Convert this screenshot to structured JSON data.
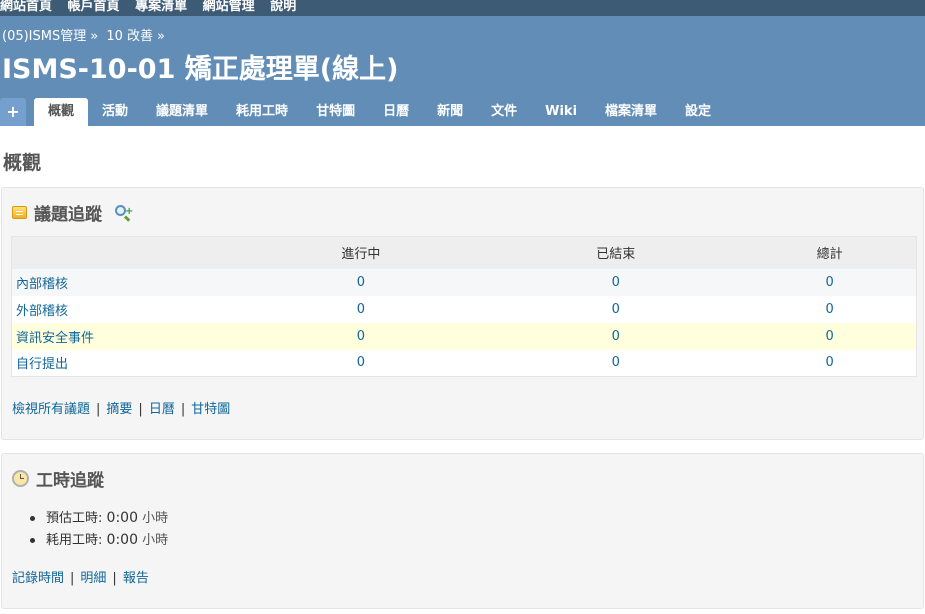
{
  "top_menu": [
    "網站首頁",
    "帳戶首頁",
    "專案清單",
    "網站管理",
    "說明"
  ],
  "breadcrumb": [
    "(05)ISMS管理",
    "»",
    "10 改善",
    "»"
  ],
  "project_title": "ISMS-10-01 矯正處理單(線上)",
  "tabs": [
    {
      "label": "+",
      "selected": false
    },
    {
      "label": "概觀",
      "selected": true
    },
    {
      "label": "活動",
      "selected": false
    },
    {
      "label": "議題清單",
      "selected": false
    },
    {
      "label": "耗用工時",
      "selected": false
    },
    {
      "label": "甘特圖",
      "selected": false
    },
    {
      "label": "日曆",
      "selected": false
    },
    {
      "label": "新聞",
      "selected": false
    },
    {
      "label": "文件",
      "selected": false
    },
    {
      "label": "Wiki",
      "selected": false
    },
    {
      "label": "檔案清單",
      "selected": false
    },
    {
      "label": "設定",
      "selected": false
    }
  ],
  "page_heading": "概觀",
  "issue_tracking": {
    "title": "議題追蹤",
    "columns": [
      "",
      "進行中",
      "已結束",
      "總計"
    ],
    "rows": [
      {
        "name": "內部稽核",
        "open": "0",
        "closed": "0",
        "total": "0"
      },
      {
        "name": "外部稽核",
        "open": "0",
        "closed": "0",
        "total": "0"
      },
      {
        "name": "資訊安全事件",
        "open": "0",
        "closed": "0",
        "total": "0"
      },
      {
        "name": "自行提出",
        "open": "0",
        "closed": "0",
        "total": "0"
      }
    ],
    "links": [
      "檢視所有議題",
      "摘要",
      "日曆",
      "甘特圖"
    ],
    "separator": "|"
  },
  "time_tracking": {
    "title": "工時追蹤",
    "items": [
      {
        "label": "預估工時:",
        "value": "0:00",
        "unit": "小時"
      },
      {
        "label": "耗用工時:",
        "value": "0:00",
        "unit": "小時"
      }
    ],
    "links": [
      "記錄時間",
      "明細",
      "報告"
    ],
    "separator": "|"
  },
  "colors": {
    "top_bar": "#3e5b76",
    "header": "#628db6",
    "link": "#116699",
    "highlight_row": "#ffffdd"
  }
}
